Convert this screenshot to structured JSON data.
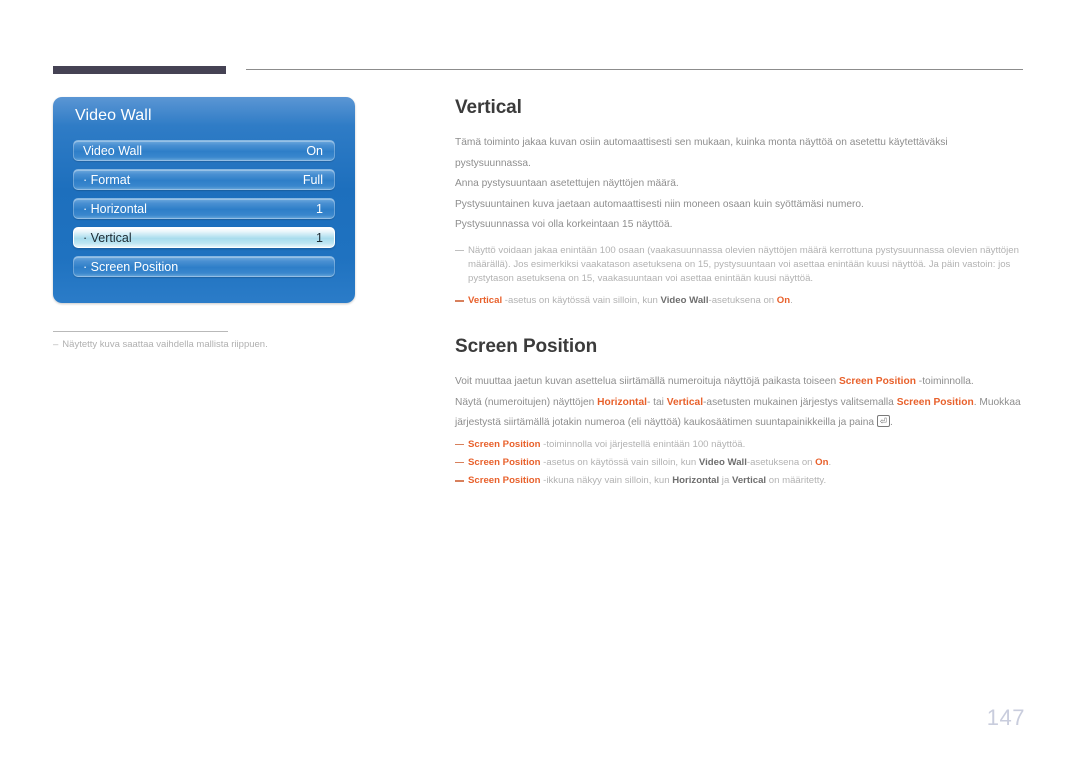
{
  "header": {
    "rule_left_color": "#454254",
    "rule_right_color": "#8c8c8c"
  },
  "osd": {
    "title": "Video Wall",
    "rows": [
      {
        "label": "Video Wall",
        "value": "On",
        "selected": false
      },
      {
        "label": "· Format",
        "value": "Full",
        "selected": false
      },
      {
        "label": "· Horizontal",
        "value": "1",
        "selected": false
      },
      {
        "label": "· Vertical",
        "value": "1",
        "selected": true
      },
      {
        "label": "· Screen Position",
        "value": "",
        "selected": false
      }
    ],
    "footnote_dash": "–",
    "footnote": "Näytetty kuva saattaa vaihdella mallista riippuen."
  },
  "sections": {
    "vertical": {
      "title": "Vertical",
      "paragraphs": [
        "Tämä toiminto jakaa kuvan osiin automaattisesti sen mukaan, kuinka monta näyttöä on asetettu käytettäväksi pystysuunnassa.",
        "Anna pystysuuntaan asetettujen näyttöjen määrä.",
        "Pystysuuntainen kuva jaetaan automaattisesti niin moneen osaan kuin syöttämäsi numero.",
        "Pystysuunnassa voi olla korkeintaan 15 näyttöä."
      ],
      "note_long": "Näyttö voidaan jakaa enintään 100 osaan (vaakasuunnassa olevien näyttöjen määrä kerrottuna pystysuunnassa olevien näyttöjen määrällä). Jos esimerkiksi vaakatason asetuksena on 15, pystysuuntaan voi asettaa enintään kuusi näyttöä. Ja päin vastoin: jos pystytason asetuksena on 15, vaakasuuntaan voi asettaa enintään kuusi näyttöä.",
      "note2": {
        "term1": "Vertical",
        "mid1": " -asetus on käytössä vain silloin, kun ",
        "term2": "Video Wall",
        "mid2": "-asetuksena on ",
        "term3": "On",
        "end": "."
      }
    },
    "screen_position": {
      "title": "Screen Position",
      "para1": {
        "pre": "Voit muuttaa jaetun kuvan asettelua siirtämällä numeroituja näyttöjä paikasta toiseen ",
        "term1": "Screen Position",
        "post": " -toiminnolla."
      },
      "para2": {
        "pre": "Näytä (numeroitujen) näyttöjen ",
        "term1": "Horizontal",
        "mid1": "- tai ",
        "term2": "Vertical",
        "mid2": "-asetusten mukainen järjestys valitsemalla ",
        "term3": "Screen Position",
        "mid3": ". Muokkaa järjestystä siirtämällä jotakin numeroa (eli näyttöä) kaukosäätimen suuntapainikkeilla ja paina ",
        "enter_glyph": "⏎",
        "end": "."
      },
      "notes": [
        {
          "term1": "Screen Position",
          "mid1": " -toiminnolla voi järjestellä enintään 100 näyttöä.",
          "term2": "",
          "mid2": "",
          "term3": "",
          "end": ""
        },
        {
          "term1": "Screen Position",
          "mid1": " -asetus on käytössä vain silloin, kun ",
          "term2": "Video Wall",
          "mid2": "-asetuksena on ",
          "term3": "On",
          "end": "."
        },
        {
          "term1": "Screen Position",
          "mid1": " -ikkuna näkyy vain silloin, kun ",
          "term2": "Horizontal",
          "mid2": " ja ",
          "term3": "Vertical",
          "end": " on määritetty."
        }
      ]
    }
  },
  "page_number": "147"
}
